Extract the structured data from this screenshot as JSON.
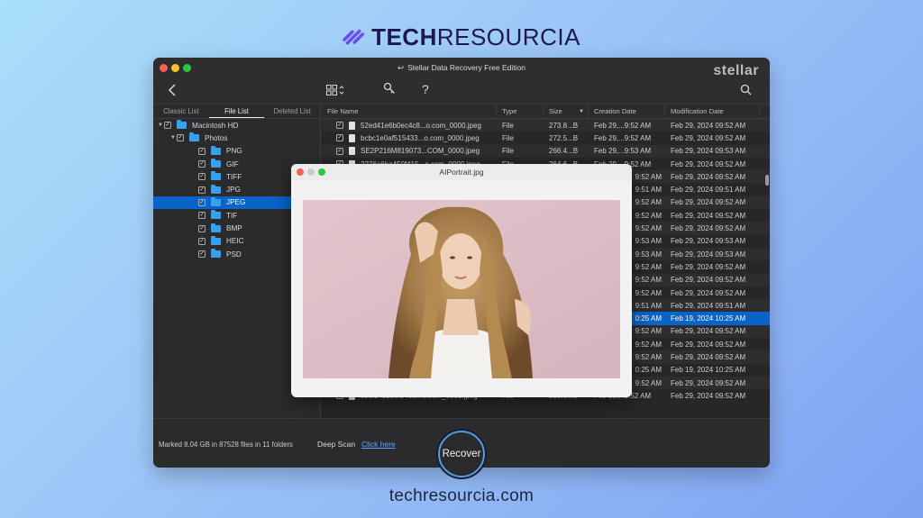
{
  "branding": {
    "logo_bold": "TECH",
    "logo_light": "RESOURCIA",
    "footer_url": "techresourcia.com"
  },
  "window": {
    "title": "Stellar Data Recovery Free Edition",
    "brand": "stellar"
  },
  "toolbar": {
    "back_icon": "chevron-left-icon",
    "view_icon": "grid-view-icon",
    "tools_icon": "wrench-icon",
    "help_label": "?",
    "search_icon": "search-icon"
  },
  "tabs": [
    {
      "label": "Classic List",
      "active": false
    },
    {
      "label": "File List",
      "active": true
    },
    {
      "label": "Deleted List",
      "active": false
    }
  ],
  "tree": [
    {
      "label": "Macintosh HD",
      "level": 0,
      "expanded": true,
      "checked": true,
      "selected": false
    },
    {
      "label": "Photos",
      "level": 1,
      "expanded": true,
      "checked": true,
      "selected": false
    },
    {
      "label": "PNG",
      "level": 2,
      "checked": true,
      "selected": false
    },
    {
      "label": "GIF",
      "level": 2,
      "checked": true,
      "selected": false
    },
    {
      "label": "TIFF",
      "level": 2,
      "checked": true,
      "selected": false
    },
    {
      "label": "JPG",
      "level": 2,
      "checked": true,
      "selected": false
    },
    {
      "label": "JPEG",
      "level": 2,
      "checked": true,
      "selected": true
    },
    {
      "label": "TIF",
      "level": 2,
      "checked": true,
      "selected": false
    },
    {
      "label": "BMP",
      "level": 2,
      "checked": true,
      "selected": false
    },
    {
      "label": "HEIC",
      "level": 2,
      "checked": true,
      "selected": false
    },
    {
      "label": "PSD",
      "level": 2,
      "checked": true,
      "selected": false
    }
  ],
  "table": {
    "columns": [
      "File Name",
      "Type",
      "Size",
      "Creation Date",
      "Modification Date"
    ],
    "rows": [
      {
        "name": "52ed41e6b0ec4c8...o.com_0000.jpeg",
        "type": "File",
        "size": "273.8...B",
        "created": "Feb 29,...9:52 AM",
        "modified": "Feb 29, 2024 09:52 AM",
        "selected": false
      },
      {
        "name": "bcbc1e0af515433...o.com_0000.jpeg",
        "type": "File",
        "size": "272.5...B",
        "created": "Feb 29,...9:52 AM",
        "modified": "Feb 29, 2024 09:52 AM",
        "selected": false
      },
      {
        "name": "SE2P216M819073...COM_0000.jpeg",
        "type": "File",
        "size": "266.4...B",
        "created": "Feb 29,...9:53 AM",
        "modified": "Feb 29, 2024 09:53 AM",
        "selected": false
      },
      {
        "name": "2276a6ba450f415...o.com_0000.jpeg",
        "type": "File",
        "size": "264.6...B",
        "created": "Feb 29,...9:52 AM",
        "modified": "Feb 29, 2024 09:52 AM",
        "selected": false
      },
      {
        "name": "",
        "type": "",
        "size": "",
        "created": "9:52 AM",
        "modified": "Feb 29, 2024 09:52 AM",
        "selected": false
      },
      {
        "name": "",
        "type": "",
        "size": "",
        "created": "9:51 AM",
        "modified": "Feb 29, 2024 09:51 AM",
        "selected": false
      },
      {
        "name": "",
        "type": "",
        "size": "",
        "created": "9:52 AM",
        "modified": "Feb 29, 2024 09:52 AM",
        "selected": false
      },
      {
        "name": "",
        "type": "",
        "size": "",
        "created": "9:52 AM",
        "modified": "Feb 29, 2024 09:52 AM",
        "selected": false
      },
      {
        "name": "",
        "type": "",
        "size": "",
        "created": "9:52 AM",
        "modified": "Feb 29, 2024 09:52 AM",
        "selected": false
      },
      {
        "name": "",
        "type": "",
        "size": "",
        "created": "9:53 AM",
        "modified": "Feb 29, 2024 09:53 AM",
        "selected": false
      },
      {
        "name": "",
        "type": "",
        "size": "",
        "created": "9:53 AM",
        "modified": "Feb 29, 2024 09:53 AM",
        "selected": false
      },
      {
        "name": "",
        "type": "",
        "size": "",
        "created": "9:52 AM",
        "modified": "Feb 29, 2024 09:52 AM",
        "selected": false
      },
      {
        "name": "",
        "type": "",
        "size": "",
        "created": "9:52 AM",
        "modified": "Feb 29, 2024 09:52 AM",
        "selected": false
      },
      {
        "name": "",
        "type": "",
        "size": "",
        "created": "9:52 AM",
        "modified": "Feb 29, 2024 09:52 AM",
        "selected": false
      },
      {
        "name": "",
        "type": "",
        "size": "",
        "created": "9:51 AM",
        "modified": "Feb 29, 2024 09:51 AM",
        "selected": false
      },
      {
        "name": "",
        "type": "",
        "size": "",
        "created": "0:25 AM",
        "modified": "Feb 19, 2024 10:25 AM",
        "selected": true
      },
      {
        "name": "",
        "type": "",
        "size": "",
        "created": "9:52 AM",
        "modified": "Feb 29, 2024 09:52 AM",
        "selected": false
      },
      {
        "name": "",
        "type": "",
        "size": "",
        "created": "9:52 AM",
        "modified": "Feb 29, 2024 09:52 AM",
        "selected": false
      },
      {
        "name": "",
        "type": "",
        "size": "",
        "created": "9:52 AM",
        "modified": "Feb 29, 2024 09:52 AM",
        "selected": false
      },
      {
        "name": "",
        "type": "",
        "size": "",
        "created": "0:25 AM",
        "modified": "Feb 19, 2024 10:25 AM",
        "selected": false
      },
      {
        "name": "",
        "type": "",
        "size": "",
        "created": "9:52 AM",
        "modified": "Feb 29, 2024 09:52 AM",
        "selected": false
      },
      {
        "name": "c38f945b50f940b...o.com_0001.jpeg",
        "type": "File",
        "size": "218.0...B",
        "created": "Feb 29,...9:52 AM",
        "modified": "Feb 29, 2024 09:52 AM",
        "selected": false
      }
    ]
  },
  "bottom": {
    "status": "Marked 8.04 GB in 87528 files in 11 folders",
    "deep_scan_label": "Deep Scan",
    "click_here": "Click here",
    "recover_label": "Recover"
  },
  "preview": {
    "title": "AIPortrait.jpg"
  },
  "colors": {
    "accent": "#0a63c9",
    "link": "#58a6ff",
    "folder": "#3ba0ea"
  }
}
